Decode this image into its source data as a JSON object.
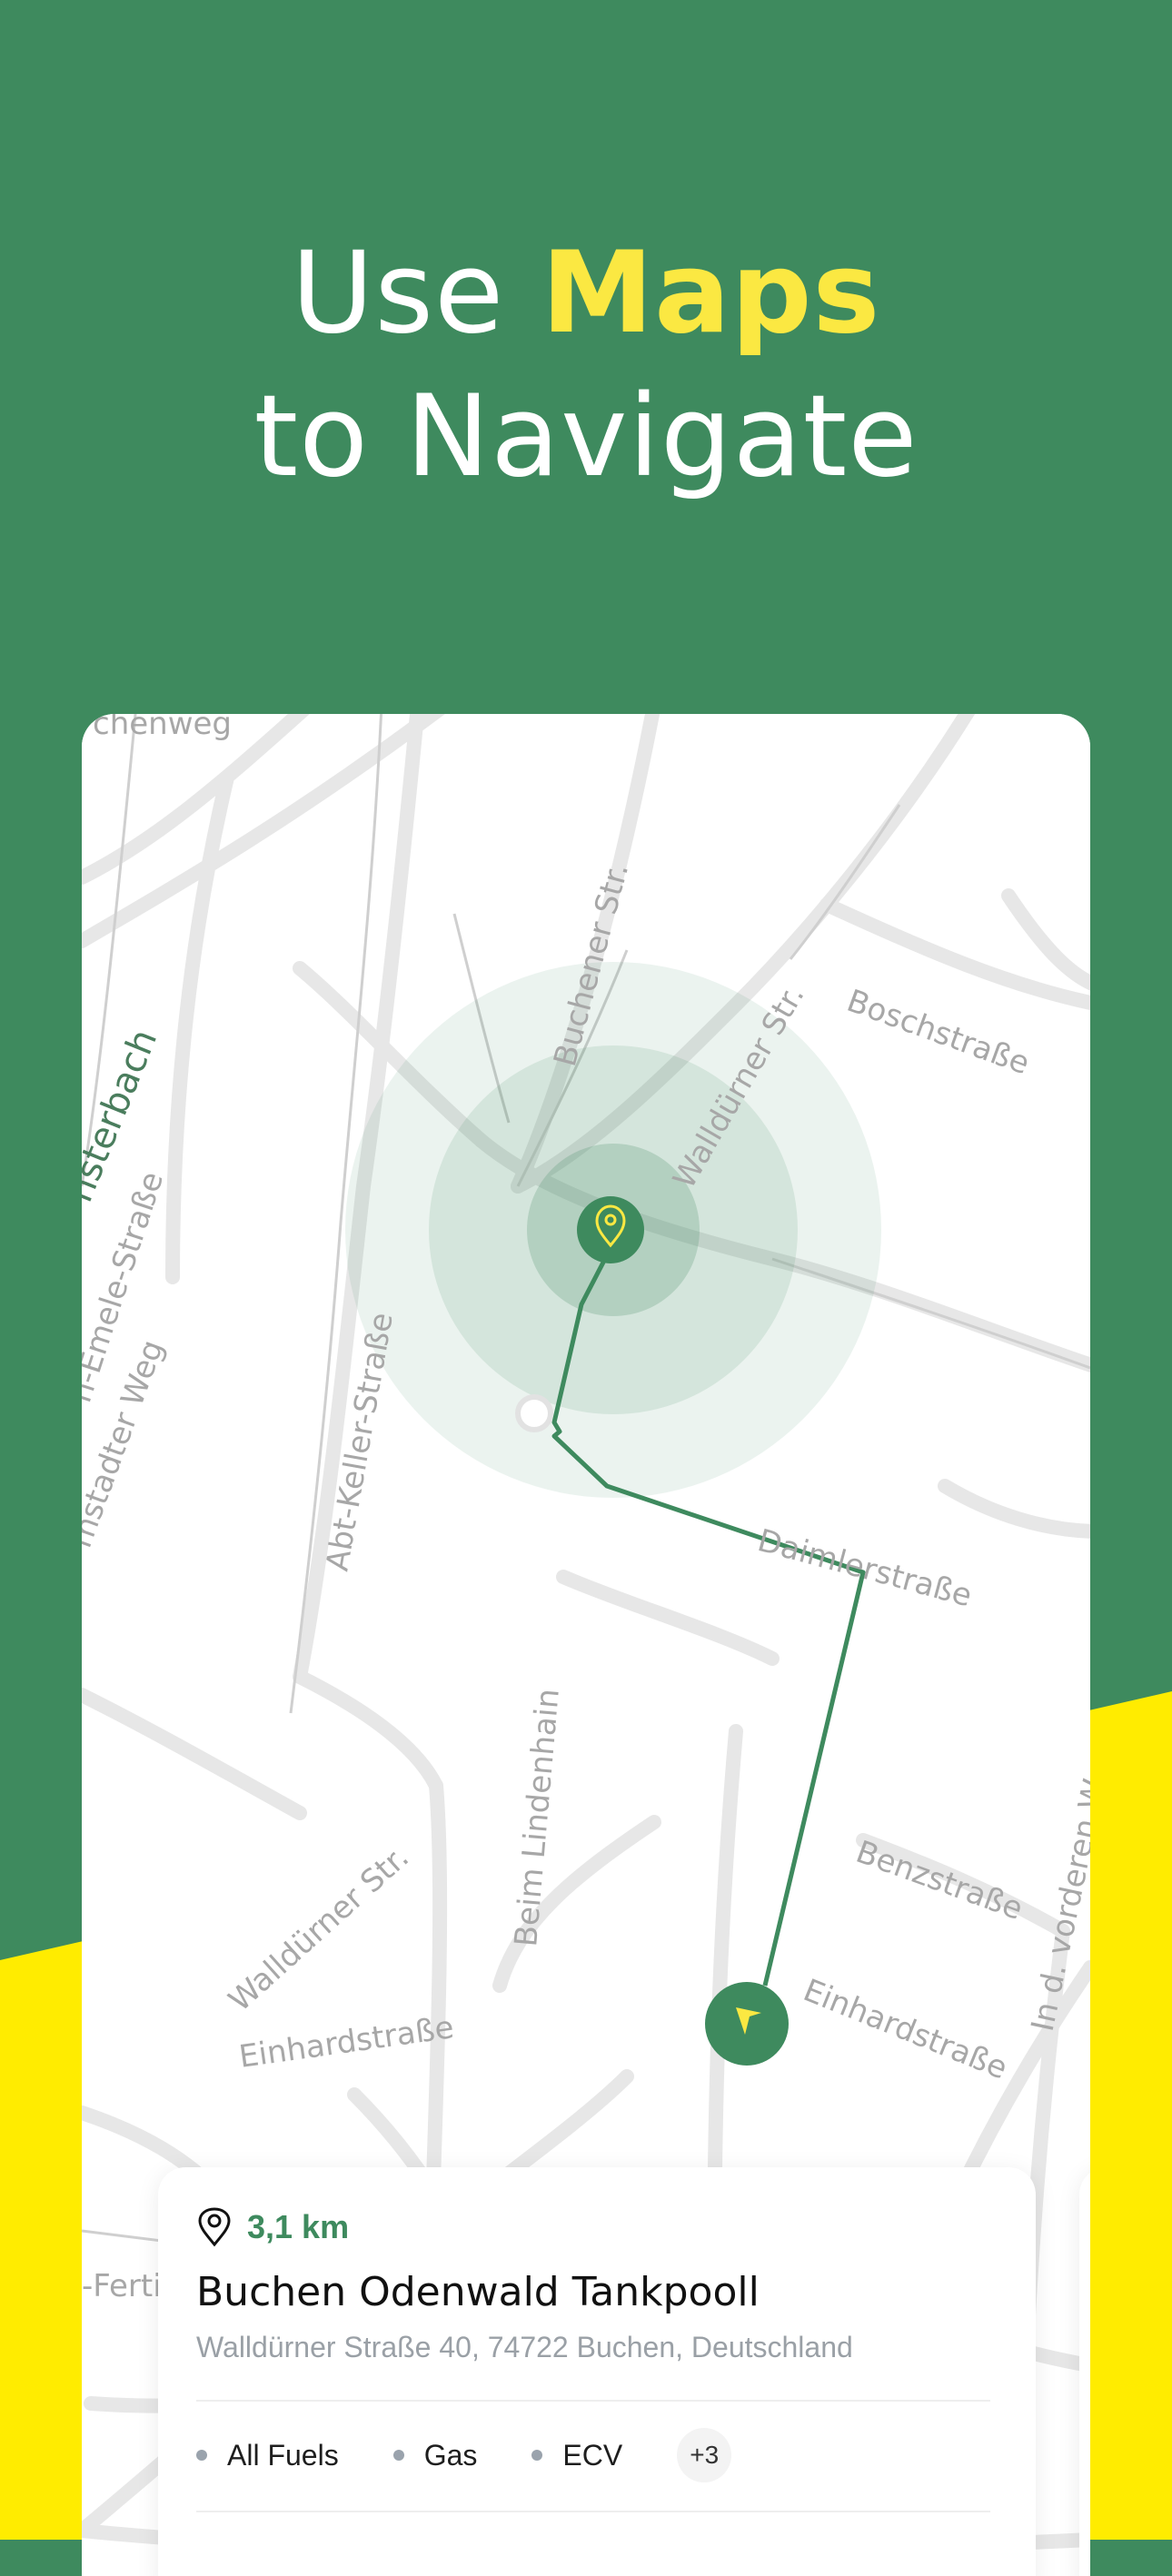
{
  "headline": {
    "line1_prefix": "Use ",
    "line1_highlight": "Maps",
    "line2": "to Navigate"
  },
  "map": {
    "street_labels": {
      "s1": "chenweg",
      "s2": "Buchener Str.",
      "s3": "Walldürner Str.",
      "s4": "Boschstraße",
      "s5": "nsterbach",
      "s6": "n-Emele-Straße",
      "s7": "mstadter Weg",
      "s8": "Abt-Keller-Straße",
      "s9": "Daimlerstraße",
      "s10": "Beim Lindenhain",
      "s11": "Benzstraße",
      "s12": "Walldürner Str.",
      "s13": "Einhardstraße",
      "s14": "Einhardstraße",
      "s15": "In d. vorderen W",
      "s16": "-Ferti"
    },
    "destination_icon": "location-pin-icon",
    "user_icon": "navigation-arrow-icon",
    "route_color": "#3e8a5e"
  },
  "station": {
    "distance": "3,1 km",
    "name": "Buchen Odenwald Tankpooll",
    "address": "Walldürner Straße 40, 74722 Buchen, Deutschland",
    "fuel_types": [
      "All Fuels",
      "Gas",
      "ECV"
    ],
    "more_count": "+3"
  },
  "colors": {
    "brand_green": "#3e8a5e",
    "accent_yellow": "#fbe842",
    "background_yellow": "#ffec00"
  }
}
